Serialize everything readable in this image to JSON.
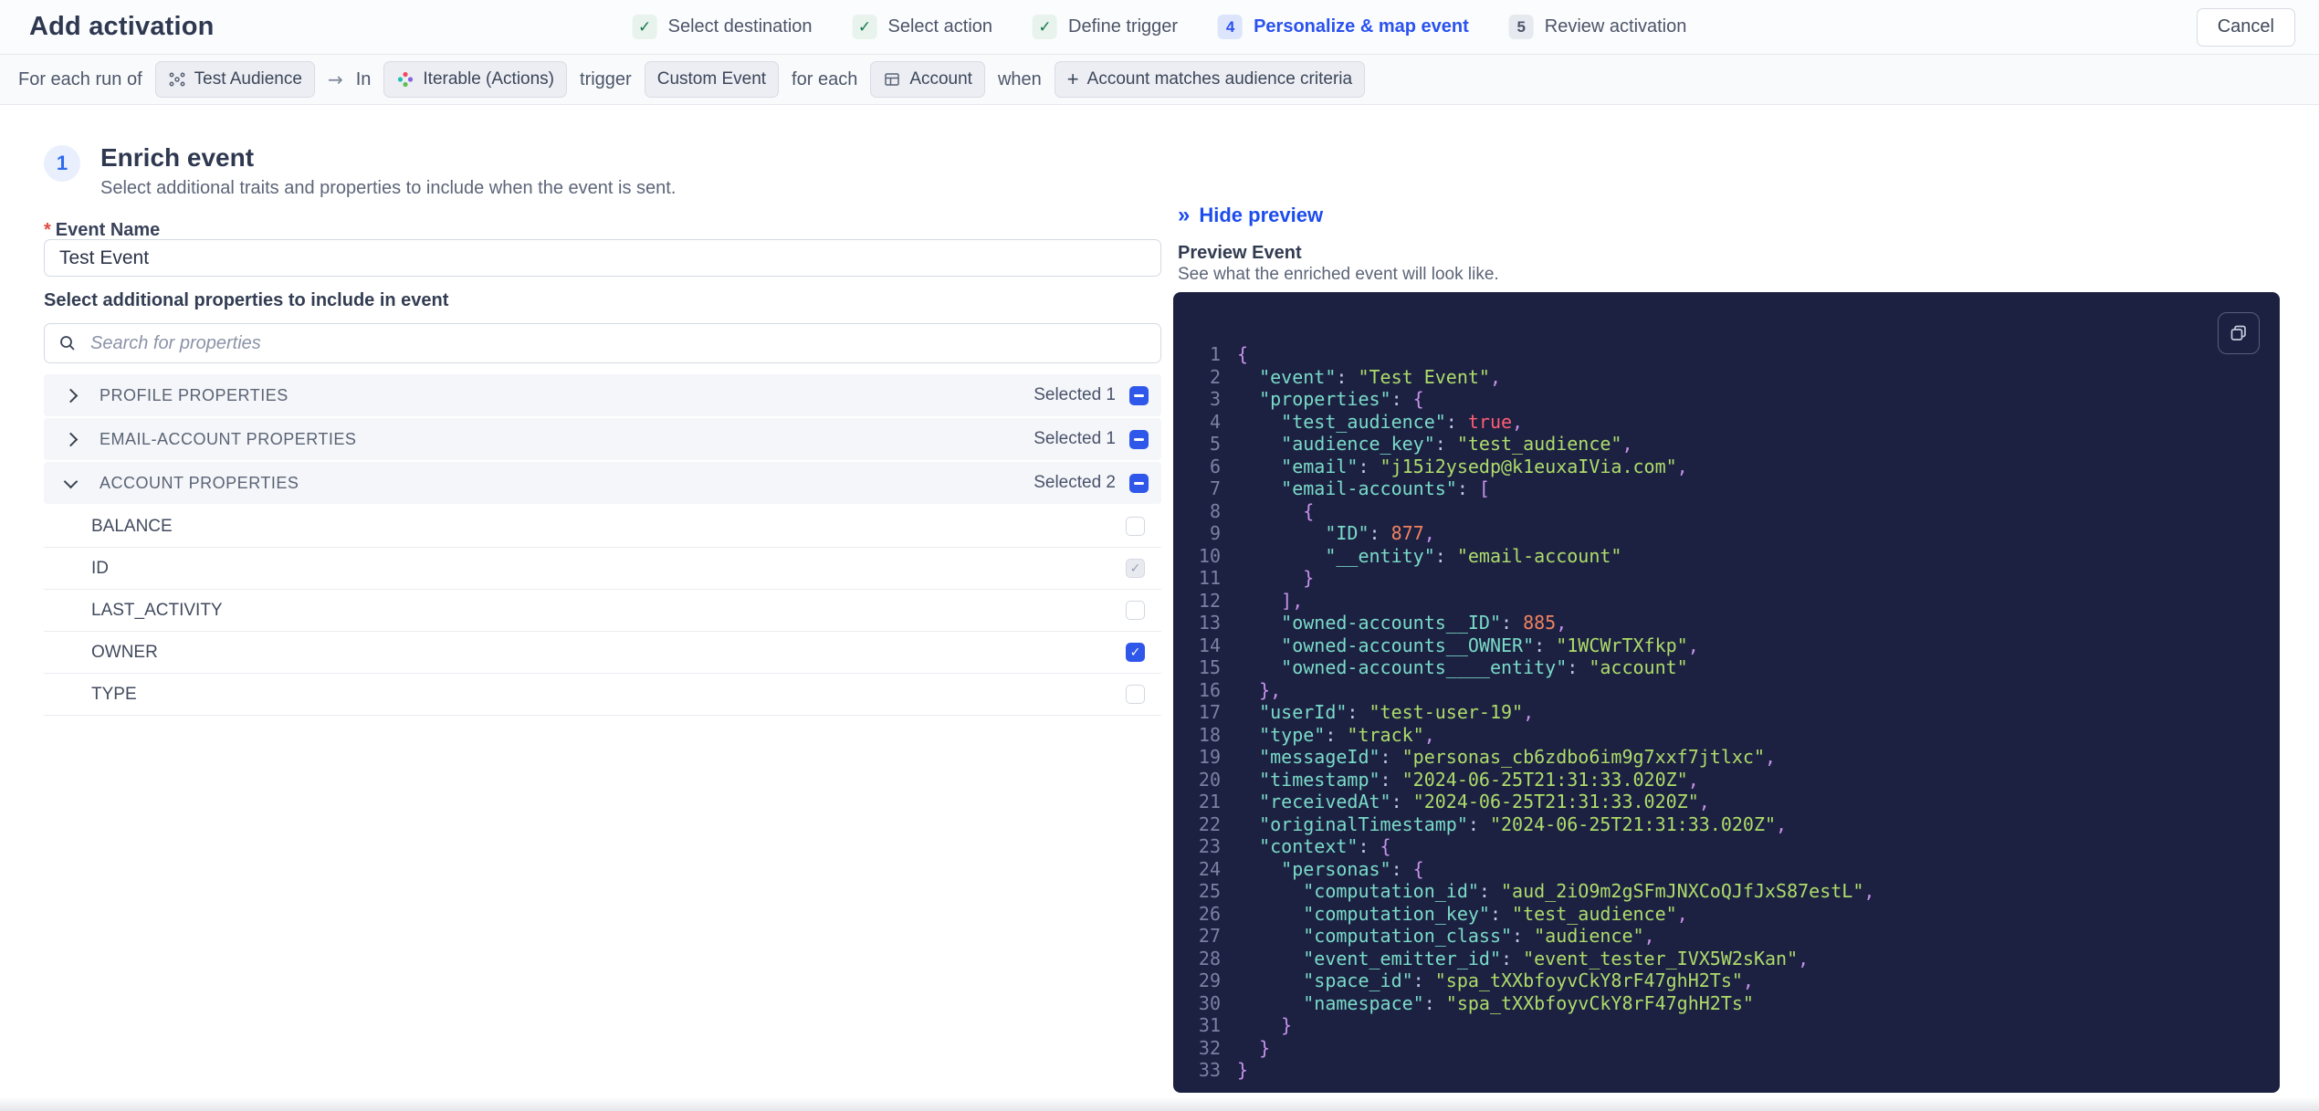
{
  "header": {
    "title": "Add activation",
    "cancel_label": "Cancel",
    "steps": [
      {
        "label": "Select destination",
        "state": "done"
      },
      {
        "label": "Select action",
        "state": "done"
      },
      {
        "label": "Define trigger",
        "state": "done"
      },
      {
        "label": "Personalize & map event",
        "state": "active",
        "number": "4"
      },
      {
        "label": "Review activation",
        "state": "upcoming",
        "number": "5"
      }
    ]
  },
  "trigger_bar": {
    "prefix": "For each run of",
    "audience": "Test Audience",
    "arrow": "→",
    "in_word": "In",
    "destination": "Iterable (Actions)",
    "trigger_word": "trigger",
    "event": "Custom Event",
    "for_each_word": "for each",
    "entity": "Account",
    "when_word": "when",
    "condition_plus": "+",
    "condition": "Account matches audience criteria"
  },
  "enrich": {
    "step_number": "1",
    "title": "Enrich event",
    "description": "Select additional traits and properties to include when the event is sent.",
    "required_marker": "*",
    "event_name_label": "Event Name",
    "event_name_value": "Test Event",
    "properties_label": "Select additional properties to include in event",
    "search_placeholder": "Search for properties"
  },
  "property_groups": [
    {
      "label": "PROFILE PROPERTIES",
      "selected_text": "Selected 1",
      "expanded": false
    },
    {
      "label": "EMAIL-ACCOUNT PROPERTIES",
      "selected_text": "Selected 1",
      "expanded": false
    },
    {
      "label": "ACCOUNT PROPERTIES",
      "selected_text": "Selected 2",
      "expanded": true
    }
  ],
  "account_properties": [
    {
      "label": "BALANCE",
      "checked": false,
      "disabled": false
    },
    {
      "label": "ID",
      "checked": true,
      "disabled": true
    },
    {
      "label": "LAST_ACTIVITY",
      "checked": false,
      "disabled": false
    },
    {
      "label": "OWNER",
      "checked": true,
      "disabled": false
    },
    {
      "label": "TYPE",
      "checked": false,
      "disabled": false
    }
  ],
  "preview": {
    "hide_icon": "»",
    "hide_label": "Hide preview",
    "title": "Preview Event",
    "description": "See what the enriched event will look like."
  },
  "colors": {
    "accent_blue": "#2a52ef",
    "checkbox_blue": "#2f57ea",
    "success_green": "#13784b",
    "code_bg": "#1c2142",
    "code_key": "#7adbc8",
    "code_string": "#aedc6a",
    "code_number": "#f0825f",
    "code_boolean": "#ff5d73",
    "code_punct": "#c792ea"
  },
  "code": {
    "lines": [
      {
        "n": 1,
        "seg": [
          [
            "p",
            "{"
          ]
        ]
      },
      {
        "n": 2,
        "seg": [
          [
            "k",
            "  \"event\""
          ],
          [
            "c",
            ": "
          ],
          [
            "s",
            "\"Test Event\""
          ],
          [
            "m",
            ","
          ]
        ]
      },
      {
        "n": 3,
        "seg": [
          [
            "k",
            "  \"properties\""
          ],
          [
            "c",
            ": "
          ],
          [
            "p",
            "{"
          ]
        ]
      },
      {
        "n": 4,
        "seg": [
          [
            "k",
            "    \"test_audience\""
          ],
          [
            "c",
            ": "
          ],
          [
            "b",
            "true"
          ],
          [
            "m",
            ","
          ]
        ]
      },
      {
        "n": 5,
        "seg": [
          [
            "k",
            "    \"audience_key\""
          ],
          [
            "c",
            ": "
          ],
          [
            "s",
            "\"test_audience\""
          ],
          [
            "m",
            ","
          ]
        ]
      },
      {
        "n": 6,
        "seg": [
          [
            "k",
            "    \"email\""
          ],
          [
            "c",
            ": "
          ],
          [
            "s",
            "\"j15i2ysedp@k1euxaIVia.com\""
          ],
          [
            "m",
            ","
          ]
        ]
      },
      {
        "n": 7,
        "seg": [
          [
            "k",
            "    \"email-accounts\""
          ],
          [
            "c",
            ": "
          ],
          [
            "p",
            "["
          ]
        ]
      },
      {
        "n": 8,
        "seg": [
          [
            "p",
            "      {"
          ]
        ]
      },
      {
        "n": 9,
        "seg": [
          [
            "k",
            "        \"ID\""
          ],
          [
            "c",
            ": "
          ],
          [
            "n",
            "877"
          ],
          [
            "m",
            ","
          ]
        ]
      },
      {
        "n": 10,
        "seg": [
          [
            "k",
            "        \"__entity\""
          ],
          [
            "c",
            ": "
          ],
          [
            "s",
            "\"email-account\""
          ]
        ]
      },
      {
        "n": 11,
        "seg": [
          [
            "p",
            "      }"
          ]
        ]
      },
      {
        "n": 12,
        "seg": [
          [
            "p",
            "    ]"
          ],
          [
            "m",
            ","
          ]
        ]
      },
      {
        "n": 13,
        "seg": [
          [
            "k",
            "    \"owned-accounts__ID\""
          ],
          [
            "c",
            ": "
          ],
          [
            "n",
            "885"
          ],
          [
            "m",
            ","
          ]
        ]
      },
      {
        "n": 14,
        "seg": [
          [
            "k",
            "    \"owned-accounts__OWNER\""
          ],
          [
            "c",
            ": "
          ],
          [
            "s",
            "\"1WCWrTXfkp\""
          ],
          [
            "m",
            ","
          ]
        ]
      },
      {
        "n": 15,
        "seg": [
          [
            "k",
            "    \"owned-accounts____entity\""
          ],
          [
            "c",
            ": "
          ],
          [
            "s",
            "\"account\""
          ]
        ]
      },
      {
        "n": 16,
        "seg": [
          [
            "p",
            "  }"
          ],
          [
            "m",
            ","
          ]
        ]
      },
      {
        "n": 17,
        "seg": [
          [
            "k",
            "  \"userId\""
          ],
          [
            "c",
            ": "
          ],
          [
            "s",
            "\"test-user-19\""
          ],
          [
            "m",
            ","
          ]
        ]
      },
      {
        "n": 18,
        "seg": [
          [
            "k",
            "  \"type\""
          ],
          [
            "c",
            ": "
          ],
          [
            "s",
            "\"track\""
          ],
          [
            "m",
            ","
          ]
        ]
      },
      {
        "n": 19,
        "seg": [
          [
            "k",
            "  \"messageId\""
          ],
          [
            "c",
            ": "
          ],
          [
            "s",
            "\"personas_cb6zdbo6im9g7xxf7jtlxc\""
          ],
          [
            "m",
            ","
          ]
        ]
      },
      {
        "n": 20,
        "seg": [
          [
            "k",
            "  \"timestamp\""
          ],
          [
            "c",
            ": "
          ],
          [
            "s",
            "\"2024-06-25T21:31:33.020Z\""
          ],
          [
            "m",
            ","
          ]
        ]
      },
      {
        "n": 21,
        "seg": [
          [
            "k",
            "  \"receivedAt\""
          ],
          [
            "c",
            ": "
          ],
          [
            "s",
            "\"2024-06-25T21:31:33.020Z\""
          ],
          [
            "m",
            ","
          ]
        ]
      },
      {
        "n": 22,
        "seg": [
          [
            "k",
            "  \"originalTimestamp\""
          ],
          [
            "c",
            ": "
          ],
          [
            "s",
            "\"2024-06-25T21:31:33.020Z\""
          ],
          [
            "m",
            ","
          ]
        ]
      },
      {
        "n": 23,
        "seg": [
          [
            "k",
            "  \"context\""
          ],
          [
            "c",
            ": "
          ],
          [
            "p",
            "{"
          ]
        ]
      },
      {
        "n": 24,
        "seg": [
          [
            "k",
            "    \"personas\""
          ],
          [
            "c",
            ": "
          ],
          [
            "p",
            "{"
          ]
        ]
      },
      {
        "n": 25,
        "seg": [
          [
            "k",
            "      \"computation_id\""
          ],
          [
            "c",
            ": "
          ],
          [
            "s",
            "\"aud_2iO9m2gSFmJNXCoQJfJxS87estL\""
          ],
          [
            "m",
            ","
          ]
        ]
      },
      {
        "n": 26,
        "seg": [
          [
            "k",
            "      \"computation_key\""
          ],
          [
            "c",
            ": "
          ],
          [
            "s",
            "\"test_audience\""
          ],
          [
            "m",
            ","
          ]
        ]
      },
      {
        "n": 27,
        "seg": [
          [
            "k",
            "      \"computation_class\""
          ],
          [
            "c",
            ": "
          ],
          [
            "s",
            "\"audience\""
          ],
          [
            "m",
            ","
          ]
        ]
      },
      {
        "n": 28,
        "seg": [
          [
            "k",
            "      \"event_emitter_id\""
          ],
          [
            "c",
            ": "
          ],
          [
            "s",
            "\"event_tester_IVX5W2sKan\""
          ],
          [
            "m",
            ","
          ]
        ]
      },
      {
        "n": 29,
        "seg": [
          [
            "k",
            "      \"space_id\""
          ],
          [
            "c",
            ": "
          ],
          [
            "s",
            "\"spa_tXXbfoyvCkY8rF47ghH2Ts\""
          ],
          [
            "m",
            ","
          ]
        ]
      },
      {
        "n": 30,
        "seg": [
          [
            "k",
            "      \"namespace\""
          ],
          [
            "c",
            ": "
          ],
          [
            "s",
            "\"spa_tXXbfoyvCkY8rF47ghH2Ts\""
          ]
        ]
      },
      {
        "n": 31,
        "seg": [
          [
            "p",
            "    }"
          ]
        ]
      },
      {
        "n": 32,
        "seg": [
          [
            "p",
            "  }"
          ]
        ]
      },
      {
        "n": 33,
        "seg": [
          [
            "p",
            "}"
          ]
        ]
      }
    ]
  }
}
